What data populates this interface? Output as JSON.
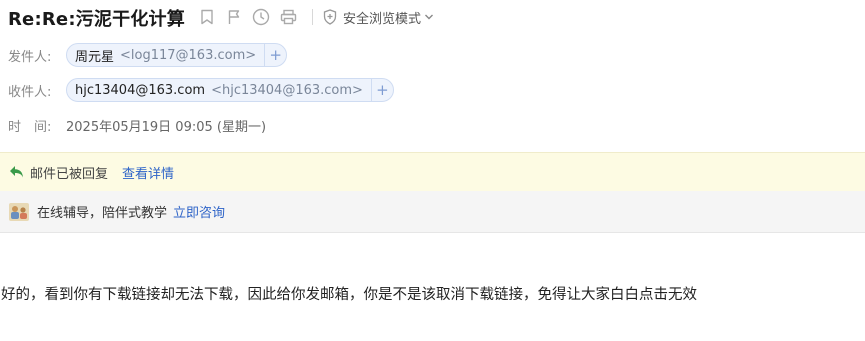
{
  "subject": "Re:Re:污泥干化计算",
  "toolbar": {
    "safe_mode_label": "安全浏览模式"
  },
  "sender": {
    "label": "发件人:",
    "name": "周元星",
    "address": "<log117@163.com>",
    "add_label": "+"
  },
  "recipient": {
    "label": "收件人:",
    "name": "hjc13404@163.com",
    "address": "<hjc13404@163.com>",
    "add_label": "+"
  },
  "time": {
    "label": "时　间:",
    "value": "2025年05月19日 09:05 (星期一)"
  },
  "reply_notice": {
    "text": "邮件已被回复",
    "link": "查看详情"
  },
  "promo": {
    "text": "在线辅导，陪伴式教学",
    "link": "立即咨询"
  },
  "body": {
    "text": "好的，看到你有下载链接却无法下载，因此给你发邮箱，你是不是该取消下载链接，免得让大家白白点击无效"
  },
  "colors": {
    "link": "#2e64c8",
    "notice_bg": "#fdfbe3",
    "chip_bg": "#eef3fc",
    "reply_icon": "#3a9a4a"
  },
  "icons": [
    "bookmark-icon",
    "flag-icon",
    "clock-icon",
    "printer-icon",
    "shield-icon",
    "chevron-down-icon",
    "reply-arrow-icon",
    "tutor-image"
  ]
}
